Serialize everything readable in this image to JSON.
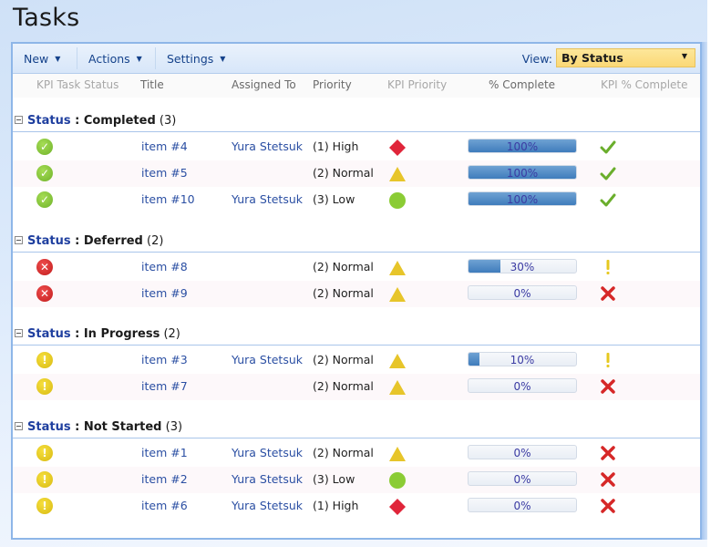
{
  "page": {
    "title": "Tasks"
  },
  "toolbar": {
    "new_label": "New",
    "actions_label": "Actions",
    "settings_label": "Settings",
    "view_label": "View:",
    "view_selected": "By Status"
  },
  "columns": {
    "kpi_task_status": "KPI Task Status",
    "title": "Title",
    "assigned_to": "Assigned To",
    "priority": "Priority",
    "kpi_priority": "KPI Priority",
    "percent_complete": "% Complete",
    "kpi_percent_complete": "KPI % Complete"
  },
  "colors": {
    "progress_fill": "#3f7cbc",
    "kpi_good": "#7cc242",
    "kpi_bad": "#d62828",
    "kpi_warn": "#e6c81f",
    "priority_high": "#e0253a",
    "priority_normal": "#e7c52a",
    "priority_low": "#8bcc35",
    "link": "#2b4fa3"
  },
  "groups": [
    {
      "field": "Status",
      "separator": " : ",
      "value": "Completed",
      "count": "(3)",
      "items": [
        {
          "status_icon": "check-circle-icon",
          "title": "item #4",
          "assigned_to": "Yura Stetsuk",
          "priority": "(1) High",
          "kpi_priority_icon": "red-diamond-icon",
          "percent": 100,
          "percent_label": "100%",
          "kpi_percent_icon": "checkmark-icon"
        },
        {
          "status_icon": "check-circle-icon",
          "title": "item #5",
          "assigned_to": "",
          "priority": "(2) Normal",
          "kpi_priority_icon": "yellow-triangle-icon",
          "percent": 100,
          "percent_label": "100%",
          "kpi_percent_icon": "checkmark-icon"
        },
        {
          "status_icon": "check-circle-icon",
          "title": "item #10",
          "assigned_to": "Yura Stetsuk",
          "priority": "(3) Low",
          "kpi_priority_icon": "green-circle-icon",
          "percent": 100,
          "percent_label": "100%",
          "kpi_percent_icon": "checkmark-icon"
        }
      ]
    },
    {
      "field": "Status",
      "separator": " : ",
      "value": "Deferred",
      "count": "(2)",
      "items": [
        {
          "status_icon": "error-circle-icon",
          "title": "item #8",
          "assigned_to": "",
          "priority": "(2) Normal",
          "kpi_priority_icon": "yellow-triangle-icon",
          "percent": 30,
          "percent_label": "30%",
          "kpi_percent_icon": "exclamation-icon"
        },
        {
          "status_icon": "error-circle-icon",
          "title": "item #9",
          "assigned_to": "",
          "priority": "(2) Normal",
          "kpi_priority_icon": "yellow-triangle-icon",
          "percent": 0,
          "percent_label": "0%",
          "kpi_percent_icon": "red-x-icon"
        }
      ]
    },
    {
      "field": "Status",
      "separator": " : ",
      "value": "In Progress",
      "count": "(2)",
      "items": [
        {
          "status_icon": "warning-circle-icon",
          "title": "item #3",
          "assigned_to": "Yura Stetsuk",
          "priority": "(2) Normal",
          "kpi_priority_icon": "yellow-triangle-icon",
          "percent": 10,
          "percent_label": "10%",
          "kpi_percent_icon": "exclamation-icon"
        },
        {
          "status_icon": "warning-circle-icon",
          "title": "item #7",
          "assigned_to": "",
          "priority": "(2) Normal",
          "kpi_priority_icon": "yellow-triangle-icon",
          "percent": 0,
          "percent_label": "0%",
          "kpi_percent_icon": "red-x-icon"
        }
      ]
    },
    {
      "field": "Status",
      "separator": " : ",
      "value": "Not Started",
      "count": "(3)",
      "items": [
        {
          "status_icon": "warning-circle-icon",
          "title": "item #1",
          "assigned_to": "Yura Stetsuk",
          "priority": "(2) Normal",
          "kpi_priority_icon": "yellow-triangle-icon",
          "percent": 0,
          "percent_label": "0%",
          "kpi_percent_icon": "red-x-icon"
        },
        {
          "status_icon": "warning-circle-icon",
          "title": "item #2",
          "assigned_to": "Yura Stetsuk",
          "priority": "(3) Low",
          "kpi_priority_icon": "green-circle-icon",
          "percent": 0,
          "percent_label": "0%",
          "kpi_percent_icon": "red-x-icon"
        },
        {
          "status_icon": "warning-circle-icon",
          "title": "item #6",
          "assigned_to": "Yura Stetsuk",
          "priority": "(1) High",
          "kpi_priority_icon": "red-diamond-icon",
          "percent": 0,
          "percent_label": "0%",
          "kpi_percent_icon": "red-x-icon"
        }
      ]
    }
  ]
}
